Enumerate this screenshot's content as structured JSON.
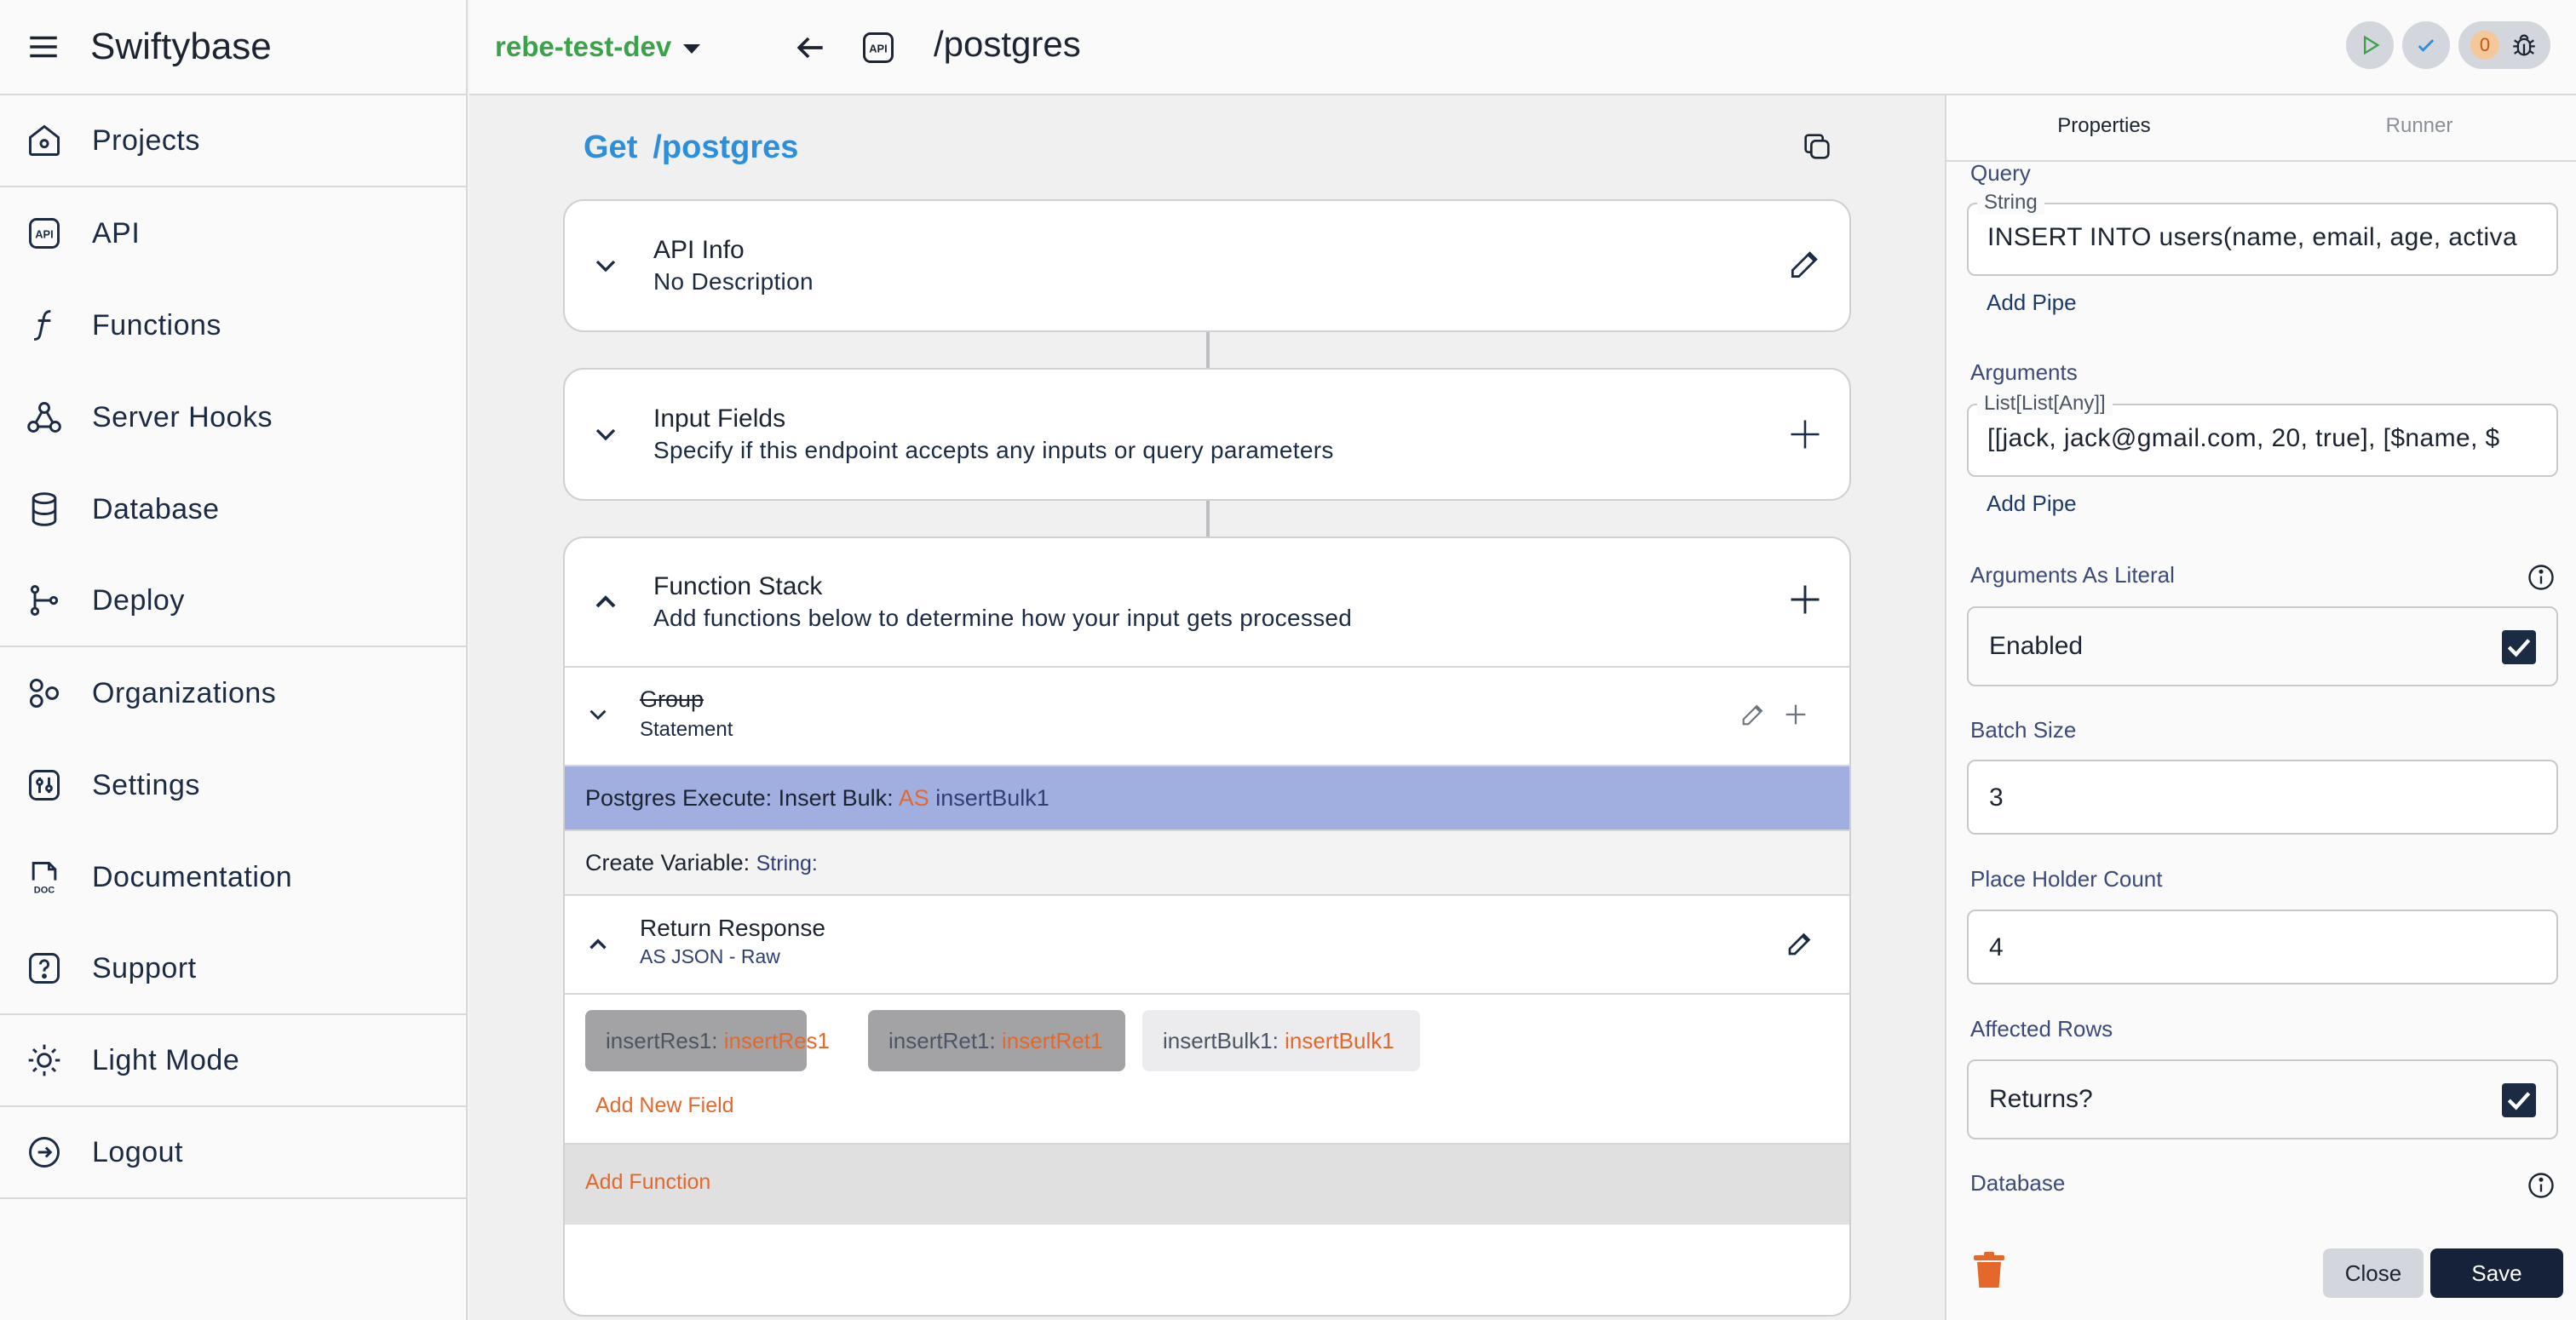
{
  "app": {
    "title": "Swiftybase"
  },
  "sidebar": {
    "items": [
      {
        "label": "Projects",
        "icon": "home-icon"
      },
      {
        "label": "API",
        "icon": "api-icon"
      },
      {
        "label": "Functions",
        "icon": "function-icon"
      },
      {
        "label": "Server Hooks",
        "icon": "webhook-icon"
      },
      {
        "label": "Database",
        "icon": "database-icon"
      },
      {
        "label": "Deploy",
        "icon": "branch-icon"
      },
      {
        "label": "Organizations",
        "icon": "organizations-icon"
      },
      {
        "label": "Settings",
        "icon": "settings-icon"
      },
      {
        "label": "Documentation",
        "icon": "doc-icon"
      },
      {
        "label": "Support",
        "icon": "help-icon"
      },
      {
        "label": "Light Mode",
        "icon": "sun-icon"
      },
      {
        "label": "Logout",
        "icon": "logout-icon"
      }
    ]
  },
  "topbar": {
    "workspace": "rebe-test-dev",
    "path": "/postgres",
    "api_badge": "API",
    "debug_count": "0"
  },
  "endpoint": {
    "method": "Get",
    "path": "/postgres"
  },
  "cards": {
    "api_info": {
      "title": "API Info",
      "subtitle": "No Description"
    },
    "input_fields": {
      "title": "Input Fields",
      "subtitle": "Specify if this endpoint accepts any inputs or query parameters"
    },
    "function_stack": {
      "title": "Function Stack",
      "subtitle": "Add functions below to determine how your input gets processed"
    }
  },
  "stack": {
    "group": {
      "title": "Group",
      "subtitle": "Statement"
    },
    "postgres_row": {
      "prefix": "Postgres Execute: Insert Bulk:",
      "as": "AS",
      "var": "insertBulk1"
    },
    "create_var_row": {
      "prefix": "Create Variable:",
      "type": "String:"
    },
    "return_response": {
      "title": "Return Response",
      "subtitle": "AS JSON - Raw"
    },
    "fields": [
      {
        "key": "insertRes1:",
        "value": "insertRes1"
      },
      {
        "key": "insertRet1:",
        "value": "insertRet1"
      },
      {
        "key": "insertBulk1:",
        "value": "insertBulk1"
      }
    ],
    "add_field": "Add New Field",
    "add_function": "Add Function"
  },
  "panel": {
    "tabs": [
      "Properties",
      "Runner"
    ],
    "query": {
      "label": "Query",
      "type": "String",
      "value": "INSERT INTO users(name, email, age, activa",
      "add_pipe": "Add Pipe"
    },
    "arguments": {
      "label": "Arguments",
      "type": "List[List[Any]]",
      "value": "[[jack, jack@gmail.com, 20, true], [$name, $",
      "add_pipe": "Add Pipe"
    },
    "args_literal": {
      "label": "Arguments As Literal",
      "value": "Enabled",
      "checked": true
    },
    "batch_size": {
      "label": "Batch Size",
      "value": "3"
    },
    "placeholder_count": {
      "label": "Place Holder Count",
      "value": "4"
    },
    "affected_rows": {
      "label": "Affected Rows",
      "value": "Returns?",
      "checked": true
    },
    "database": {
      "label": "Database"
    },
    "buttons": {
      "close": "Close",
      "save": "Save"
    }
  },
  "colors": {
    "accent_blue": "#2c8fdb",
    "workspace_green": "#3aa34a",
    "orange": "#e4682c",
    "navy": "#1c2b44",
    "highlight_row": "#a0afe0"
  }
}
